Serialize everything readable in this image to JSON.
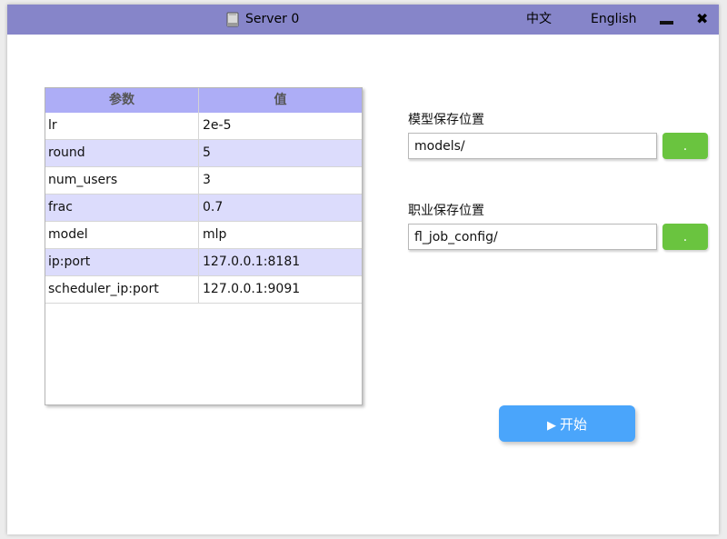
{
  "window": {
    "title": "Server 0",
    "icon": "drive-icon",
    "lang_zh": "中文",
    "lang_en": "English",
    "minimize_icon": "minimize-icon",
    "close_label": "✖",
    "titlebar_color": "#8685c9"
  },
  "table": {
    "headers": [
      "参数",
      "值"
    ],
    "rows": [
      {
        "param": "lr",
        "value": "2e-5"
      },
      {
        "param": "round",
        "value": "5"
      },
      {
        "param": "num_users",
        "value": "3"
      },
      {
        "param": "frac",
        "value": "0.7"
      },
      {
        "param": "model",
        "value": "mlp"
      },
      {
        "param": "ip:port",
        "value": "127.0.0.1:8181"
      },
      {
        "param": "scheduler_ip:port",
        "value": "127.0.0.1:9091"
      }
    ],
    "header_color": "#adadf6",
    "alt_row_color": "#dcdcfc"
  },
  "model_path": {
    "label": "模型保存位置",
    "value": "models/",
    "browse_label": "."
  },
  "job_path": {
    "label": "职业保存位置",
    "value": "fl_job_config/",
    "browse_label": "."
  },
  "start": {
    "icon": "play-icon",
    "label": "开始",
    "color": "#4aa5fb"
  }
}
